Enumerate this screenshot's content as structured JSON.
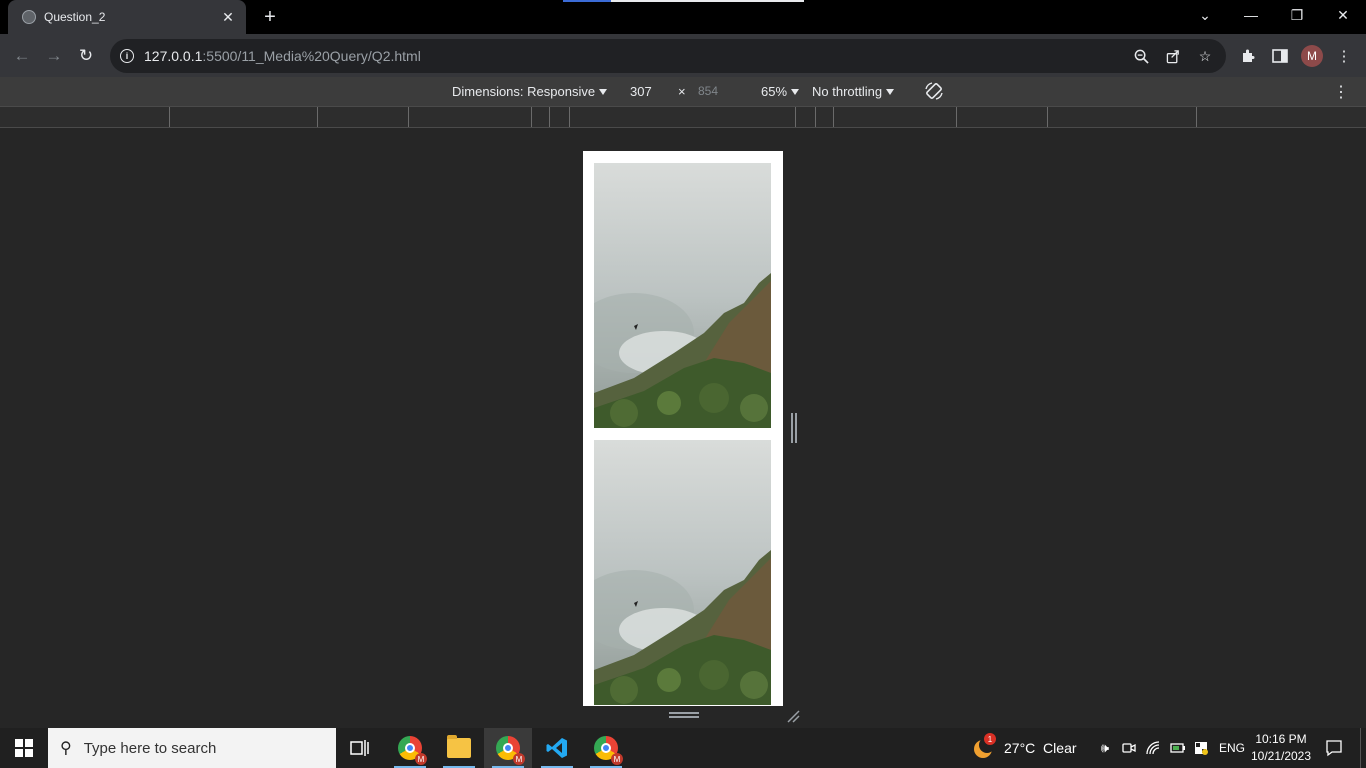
{
  "browser": {
    "tab_title": "Question_2",
    "url_host": "127.0.0.1",
    "url_path": ":5500/11_Media%20Query/Q2.html",
    "profile_initial": "M"
  },
  "device_toolbar": {
    "dimensions_label": "Dimensions: Responsive",
    "width": "307",
    "times": "×",
    "height": "854",
    "zoom": "65%",
    "throttling": "No throttling"
  },
  "taskbar": {
    "search_placeholder": "Type here to search",
    "weather": "27°C  Clear",
    "weather_badge": "1",
    "language": "ENG",
    "time": "10:16 PM",
    "date": "10/21/2023"
  },
  "colors": {
    "chrome_dark": "#35363a",
    "viewport_bg": "#262626",
    "taskbar_bg": "#202020"
  }
}
